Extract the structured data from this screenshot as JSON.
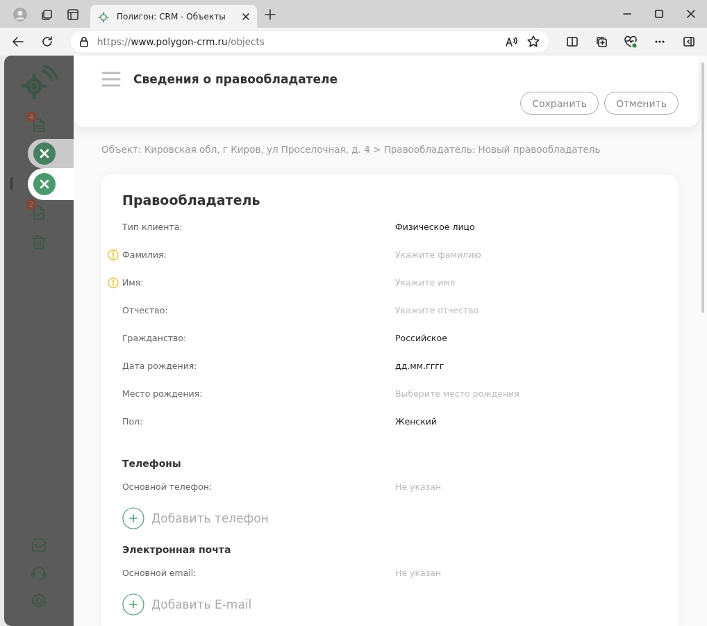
{
  "browser": {
    "tab_title": "Полигон: CRM - Объекты",
    "url": {
      "scheme": "https://",
      "host": "www.polygon-crm.ru",
      "path": "/objects"
    }
  },
  "sidebar": {
    "items": [
      {
        "kind": "document",
        "badge": "4",
        "selected": false
      },
      {
        "selected": false
      },
      {
        "selected": true
      },
      {
        "kind": "task",
        "badge": "2",
        "selected": false
      },
      {
        "kind": "trash",
        "selected": false
      }
    ],
    "bottom_items": [
      {
        "kind": "inbox"
      },
      {
        "kind": "support"
      },
      {
        "kind": "settings"
      }
    ]
  },
  "popups": [
    {
      "selected": false
    },
    {
      "selected": true
    }
  ],
  "header": {
    "title": "Сведения о правообладателе",
    "buttons": [
      "Сохранить",
      "Отменить"
    ]
  },
  "breadcrumb": "Объект: Кировская обл, г Киров, ул Проселочная, д. 4 > Правообладатель: Новый правообладатель",
  "card": {
    "title": "Правообладатель",
    "fields": [
      {
        "label": "Тип клиента:",
        "value": "Физическое лицо",
        "required": false
      },
      {
        "label": "Фамилия:",
        "placeholder": "Укажите фамилию",
        "required": true
      },
      {
        "label": "Имя:",
        "placeholder": "Укажите имя",
        "required": true
      },
      {
        "label": "Отчество:",
        "placeholder": "Укажите отчество",
        "required": false
      },
      {
        "label": "Гражданство:",
        "value": "Российское",
        "required": false
      },
      {
        "label": "Дата рождения:",
        "value": "дд.мм.гггг",
        "required": false
      },
      {
        "label": "Место рождения:",
        "placeholder": "Выберите место рождения",
        "required": false
      },
      {
        "label": "Пол:",
        "value": "Женский",
        "required": false
      }
    ],
    "sections": [
      {
        "title": "Телефоны",
        "fields": [
          {
            "label": "Основной телефон:",
            "placeholder": "Не указан"
          }
        ],
        "add_button": "Добавить телефон"
      },
      {
        "title": "Электронная почта",
        "fields": [
          {
            "label": "Основной email:",
            "placeholder": "Не указан"
          }
        ],
        "add_button": "Добавить E-mail"
      }
    ]
  }
}
